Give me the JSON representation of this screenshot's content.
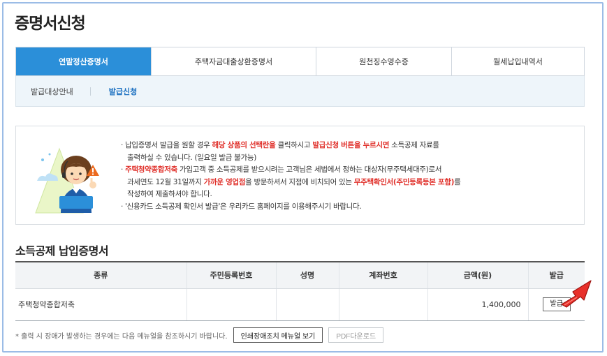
{
  "page": {
    "title": "증명서신청"
  },
  "tabs": [
    {
      "label": "연말정산증명서",
      "active": true
    },
    {
      "label": "주택자금대출상환증명서",
      "active": false
    },
    {
      "label": "원천징수영수증",
      "active": false
    },
    {
      "label": "월세납입내역서",
      "active": false
    }
  ],
  "subnav": {
    "items": [
      {
        "label": "발급대상안내",
        "active": false
      },
      {
        "label": "발급신청",
        "active": true
      }
    ]
  },
  "notice": {
    "lines": [
      [
        {
          "t": "· 납입증명서 발급을 원할 경우 "
        },
        {
          "t": "해당 상품의 선택란을",
          "hl": true
        },
        {
          "t": " 클릭하시고 "
        },
        {
          "t": "발급신청 버튼을 누르시면",
          "hl": true
        },
        {
          "t": " 소득공제 자료를"
        }
      ],
      [
        {
          "t": "   출력하실 수 있습니다. (일요일 발급 불가능)"
        }
      ],
      [
        {
          "t": "· "
        },
        {
          "t": "주택청약종합저축",
          "hl": true
        },
        {
          "t": " 가입고객 중 소득공제를 받으시려는 고객님은 세법에서 정하는 대상자(무주택세대주)로서"
        }
      ],
      [
        {
          "t": "   과세연도 12월 31일까지 "
        },
        {
          "t": "가까운 영업점",
          "hl": true
        },
        {
          "t": "을 방문하셔서 지점에 비치되어 있는 "
        },
        {
          "t": "무주택확인서(주민등록등본 포함)",
          "hl": true
        },
        {
          "t": "를"
        }
      ],
      [
        {
          "t": "   작성하여 제출하셔야 합니다."
        }
      ],
      [
        {
          "t": "· '신용카드 소득공제 확인서 발급'은 우리카드 홈페이지를 이용해주시기 바랍니다."
        }
      ]
    ],
    "colors": {
      "highlight": "#e0302a"
    }
  },
  "section": {
    "title": "소득공제 납입증명서"
  },
  "table": {
    "headers": [
      "종류",
      "주민등록번호",
      "성명",
      "계좌번호",
      "금액(원)",
      "발급"
    ],
    "rows": [
      {
        "type": "주택청약종합저축",
        "rrn": "",
        "name": "",
        "account": "",
        "amount": "1,400,000",
        "action": "발급"
      }
    ]
  },
  "footer": {
    "note": "* 출력 시 장애가 발생하는 경우에는 다음 메뉴얼을 참조하시기 바랍니다.",
    "manual_button": "인쇄장애조치 메뉴얼 보기",
    "pdf_button": "PDF다운로드"
  },
  "colors": {
    "accent": "#2b8fd9",
    "frame": "#9bbce6",
    "arrow": "#e8302a"
  },
  "icons": [
    "warning-icon",
    "red-arrow-icon"
  ]
}
